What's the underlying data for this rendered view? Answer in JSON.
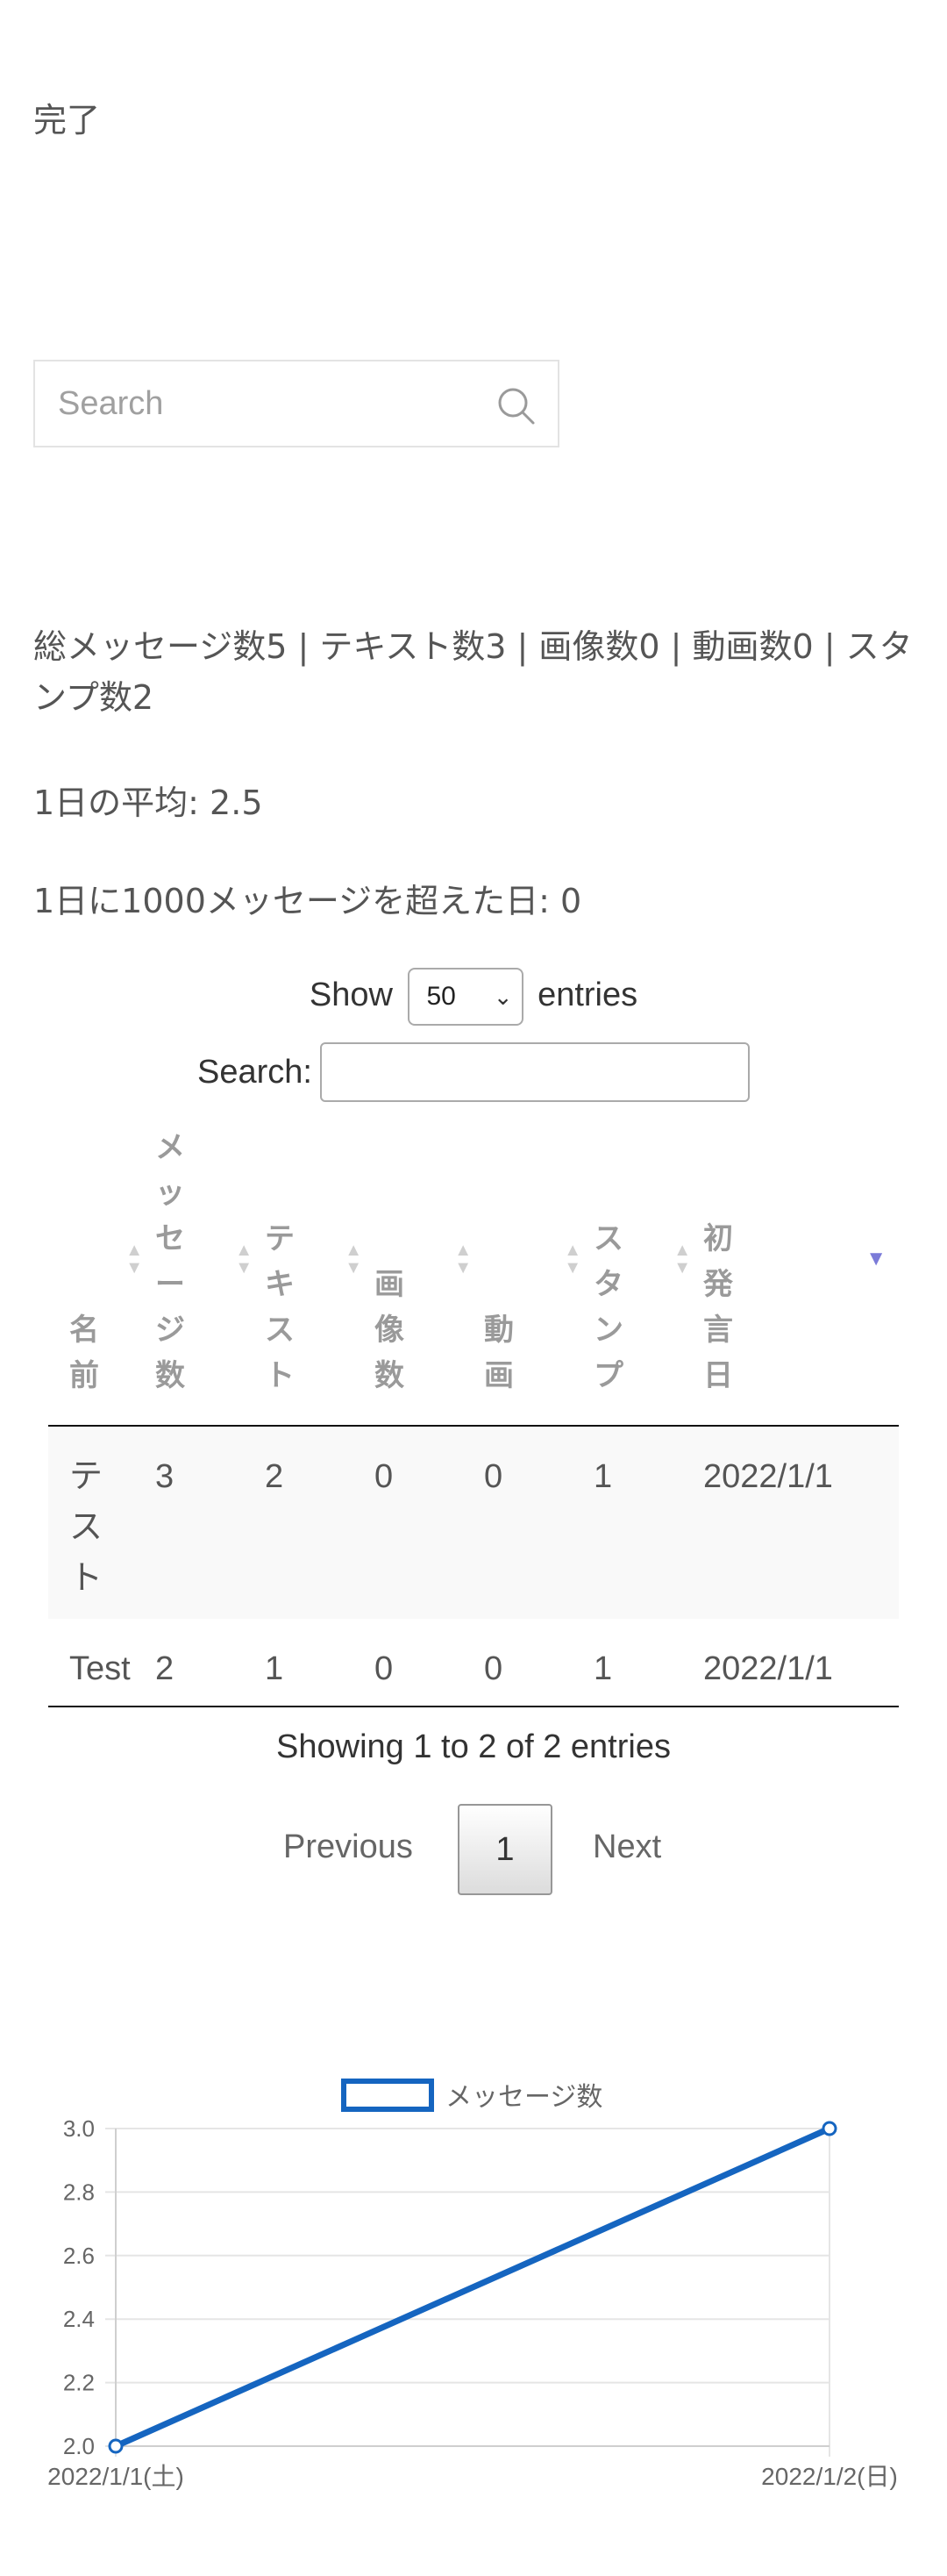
{
  "page": {
    "title": "完了"
  },
  "search": {
    "placeholder": "Search"
  },
  "summary": {
    "totals": "総メッセージ数5 | テキスト数3 | 画像数0 | 動画数0 | スタンプ数2",
    "daily_average": "1日の平均: 2.5",
    "over_1000_days": "1日に1000メッセージを超えた日: 0"
  },
  "table_controls": {
    "show_label": "Show",
    "entries_label": "entries",
    "page_length": "50",
    "search_label": "Search:"
  },
  "table": {
    "columns": [
      "名前",
      "メッセージ数",
      "テキスト",
      "画像数",
      "動画",
      "スタンプ",
      "初発言日"
    ],
    "sorted_column": "初発言日",
    "rows": [
      [
        "テスト",
        "3",
        "2",
        "0",
        "0",
        "1",
        "2022/1/1"
      ],
      [
        "Test",
        "2",
        "1",
        "0",
        "0",
        "1",
        "2022/1/1"
      ]
    ],
    "info": "Showing 1 to 2 of 2 entries"
  },
  "pagination": {
    "previous": "Previous",
    "current": "1",
    "next": "Next"
  },
  "colors": {
    "series": "#1565c0",
    "grid": "#e5e5e5",
    "sort_active": "#7b7bd8"
  },
  "chart_data": {
    "type": "line",
    "categories": [
      "2022/1/1(土)",
      "2022/1/2(日)"
    ],
    "series": [
      {
        "name": "メッセージ数",
        "values": [
          2,
          3
        ]
      }
    ],
    "ylim": [
      2.0,
      3.0
    ],
    "yticks": [
      "2.0",
      "2.2",
      "2.4",
      "2.6",
      "2.8",
      "3.0"
    ],
    "legend": "top",
    "grid": true
  }
}
